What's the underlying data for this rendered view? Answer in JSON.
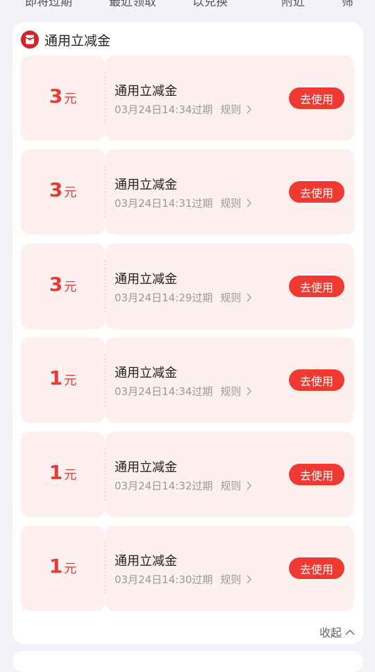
{
  "top_tabs": [
    "即将过期",
    "最近领取",
    "以兑换",
    "附近",
    "筛"
  ],
  "section": {
    "title": "通用立减金",
    "collapse_label": "收起"
  },
  "coupons": [
    {
      "amount": "3",
      "unit": "元",
      "name": "通用立减金",
      "expiry": "03月24日14:34过期",
      "rule": "规则",
      "button": "去使用"
    },
    {
      "amount": "3",
      "unit": "元",
      "name": "通用立减金",
      "expiry": "03月24日14:31过期",
      "rule": "规则",
      "button": "去使用"
    },
    {
      "amount": "3",
      "unit": "元",
      "name": "通用立减金",
      "expiry": "03月24日14:29过期",
      "rule": "规则",
      "button": "去使用"
    },
    {
      "amount": "1",
      "unit": "元",
      "name": "通用立减金",
      "expiry": "03月24日14:34过期",
      "rule": "规则",
      "button": "去使用"
    },
    {
      "amount": "1",
      "unit": "元",
      "name": "通用立减金",
      "expiry": "03月24日14:32过期",
      "rule": "规则",
      "button": "去使用"
    },
    {
      "amount": "1",
      "unit": "元",
      "name": "通用立减金",
      "expiry": "03月24日14:30过期",
      "rule": "规则",
      "button": "去使用"
    }
  ],
  "colors": {
    "accent": "#ee3a32",
    "amount": "#e93a33",
    "coupon_bg": "#fff0f0",
    "page_bg": "#f1f3f8"
  },
  "icons": {
    "section_icon": "red-envelope-icon",
    "rule_chevron": "chevron-right-icon",
    "collapse_chevron": "chevron-up-icon"
  }
}
